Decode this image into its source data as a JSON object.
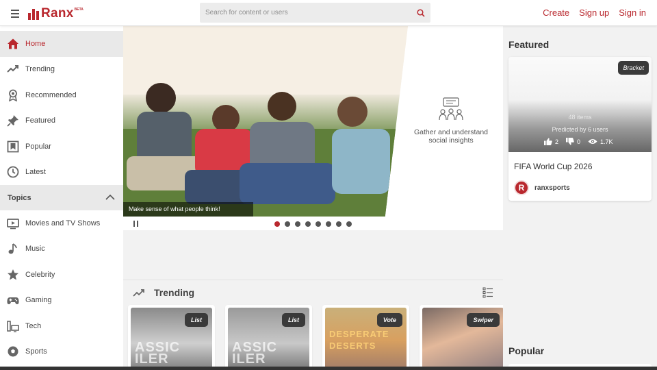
{
  "header": {
    "logo_text": "Ranx",
    "logo_badge": "BETA",
    "search_placeholder": "Search for content or users",
    "links": {
      "create": "Create",
      "signup": "Sign up",
      "signin": "Sign in"
    }
  },
  "sidebar": {
    "items": [
      {
        "label": "Home",
        "icon": "home-icon",
        "active": true
      },
      {
        "label": "Trending",
        "icon": "trending-icon"
      },
      {
        "label": "Recommended",
        "icon": "ribbon-icon"
      },
      {
        "label": "Featured",
        "icon": "pin-icon"
      },
      {
        "label": "Popular",
        "icon": "bookmark-icon"
      },
      {
        "label": "Latest",
        "icon": "clock-icon"
      }
    ],
    "topics_label": "Topics",
    "topics": [
      {
        "label": "Movies and TV Shows",
        "icon": "tv-icon"
      },
      {
        "label": "Music",
        "icon": "music-note-icon"
      },
      {
        "label": "Celebrity",
        "icon": "star-icon"
      },
      {
        "label": "Gaming",
        "icon": "gamepad-icon"
      },
      {
        "label": "Tech",
        "icon": "tech-icon"
      },
      {
        "label": "Sports",
        "icon": "ball-icon"
      }
    ]
  },
  "hero": {
    "caption": "Make sense of what people think!",
    "tagline": "Gather and understand social insights",
    "slide_count": 8,
    "active_slide": 1
  },
  "trending": {
    "title": "Trending",
    "cards": [
      {
        "tag": "List",
        "overlay": "ASSIC\nILER"
      },
      {
        "tag": "List",
        "overlay": "ASSIC\nILER"
      },
      {
        "tag": "Vote",
        "overlay": "DESPERATE\nDESERTS"
      },
      {
        "tag": "Swiper",
        "overlay": ""
      }
    ]
  },
  "right": {
    "featured_title": "Featured",
    "featured_card": {
      "tag": "Bracket",
      "items": "48 items",
      "predicted": "Predicted by 6 users",
      "likes": "2",
      "dislikes": "0",
      "views": "1.7K",
      "name": "FIFA World Cup 2026",
      "user": "ranxsports",
      "avatar_letter": "R"
    },
    "popular_title": "Popular"
  },
  "colors": {
    "brand": "#b9282e",
    "text": "#333333",
    "background": "#f2f2f2"
  }
}
